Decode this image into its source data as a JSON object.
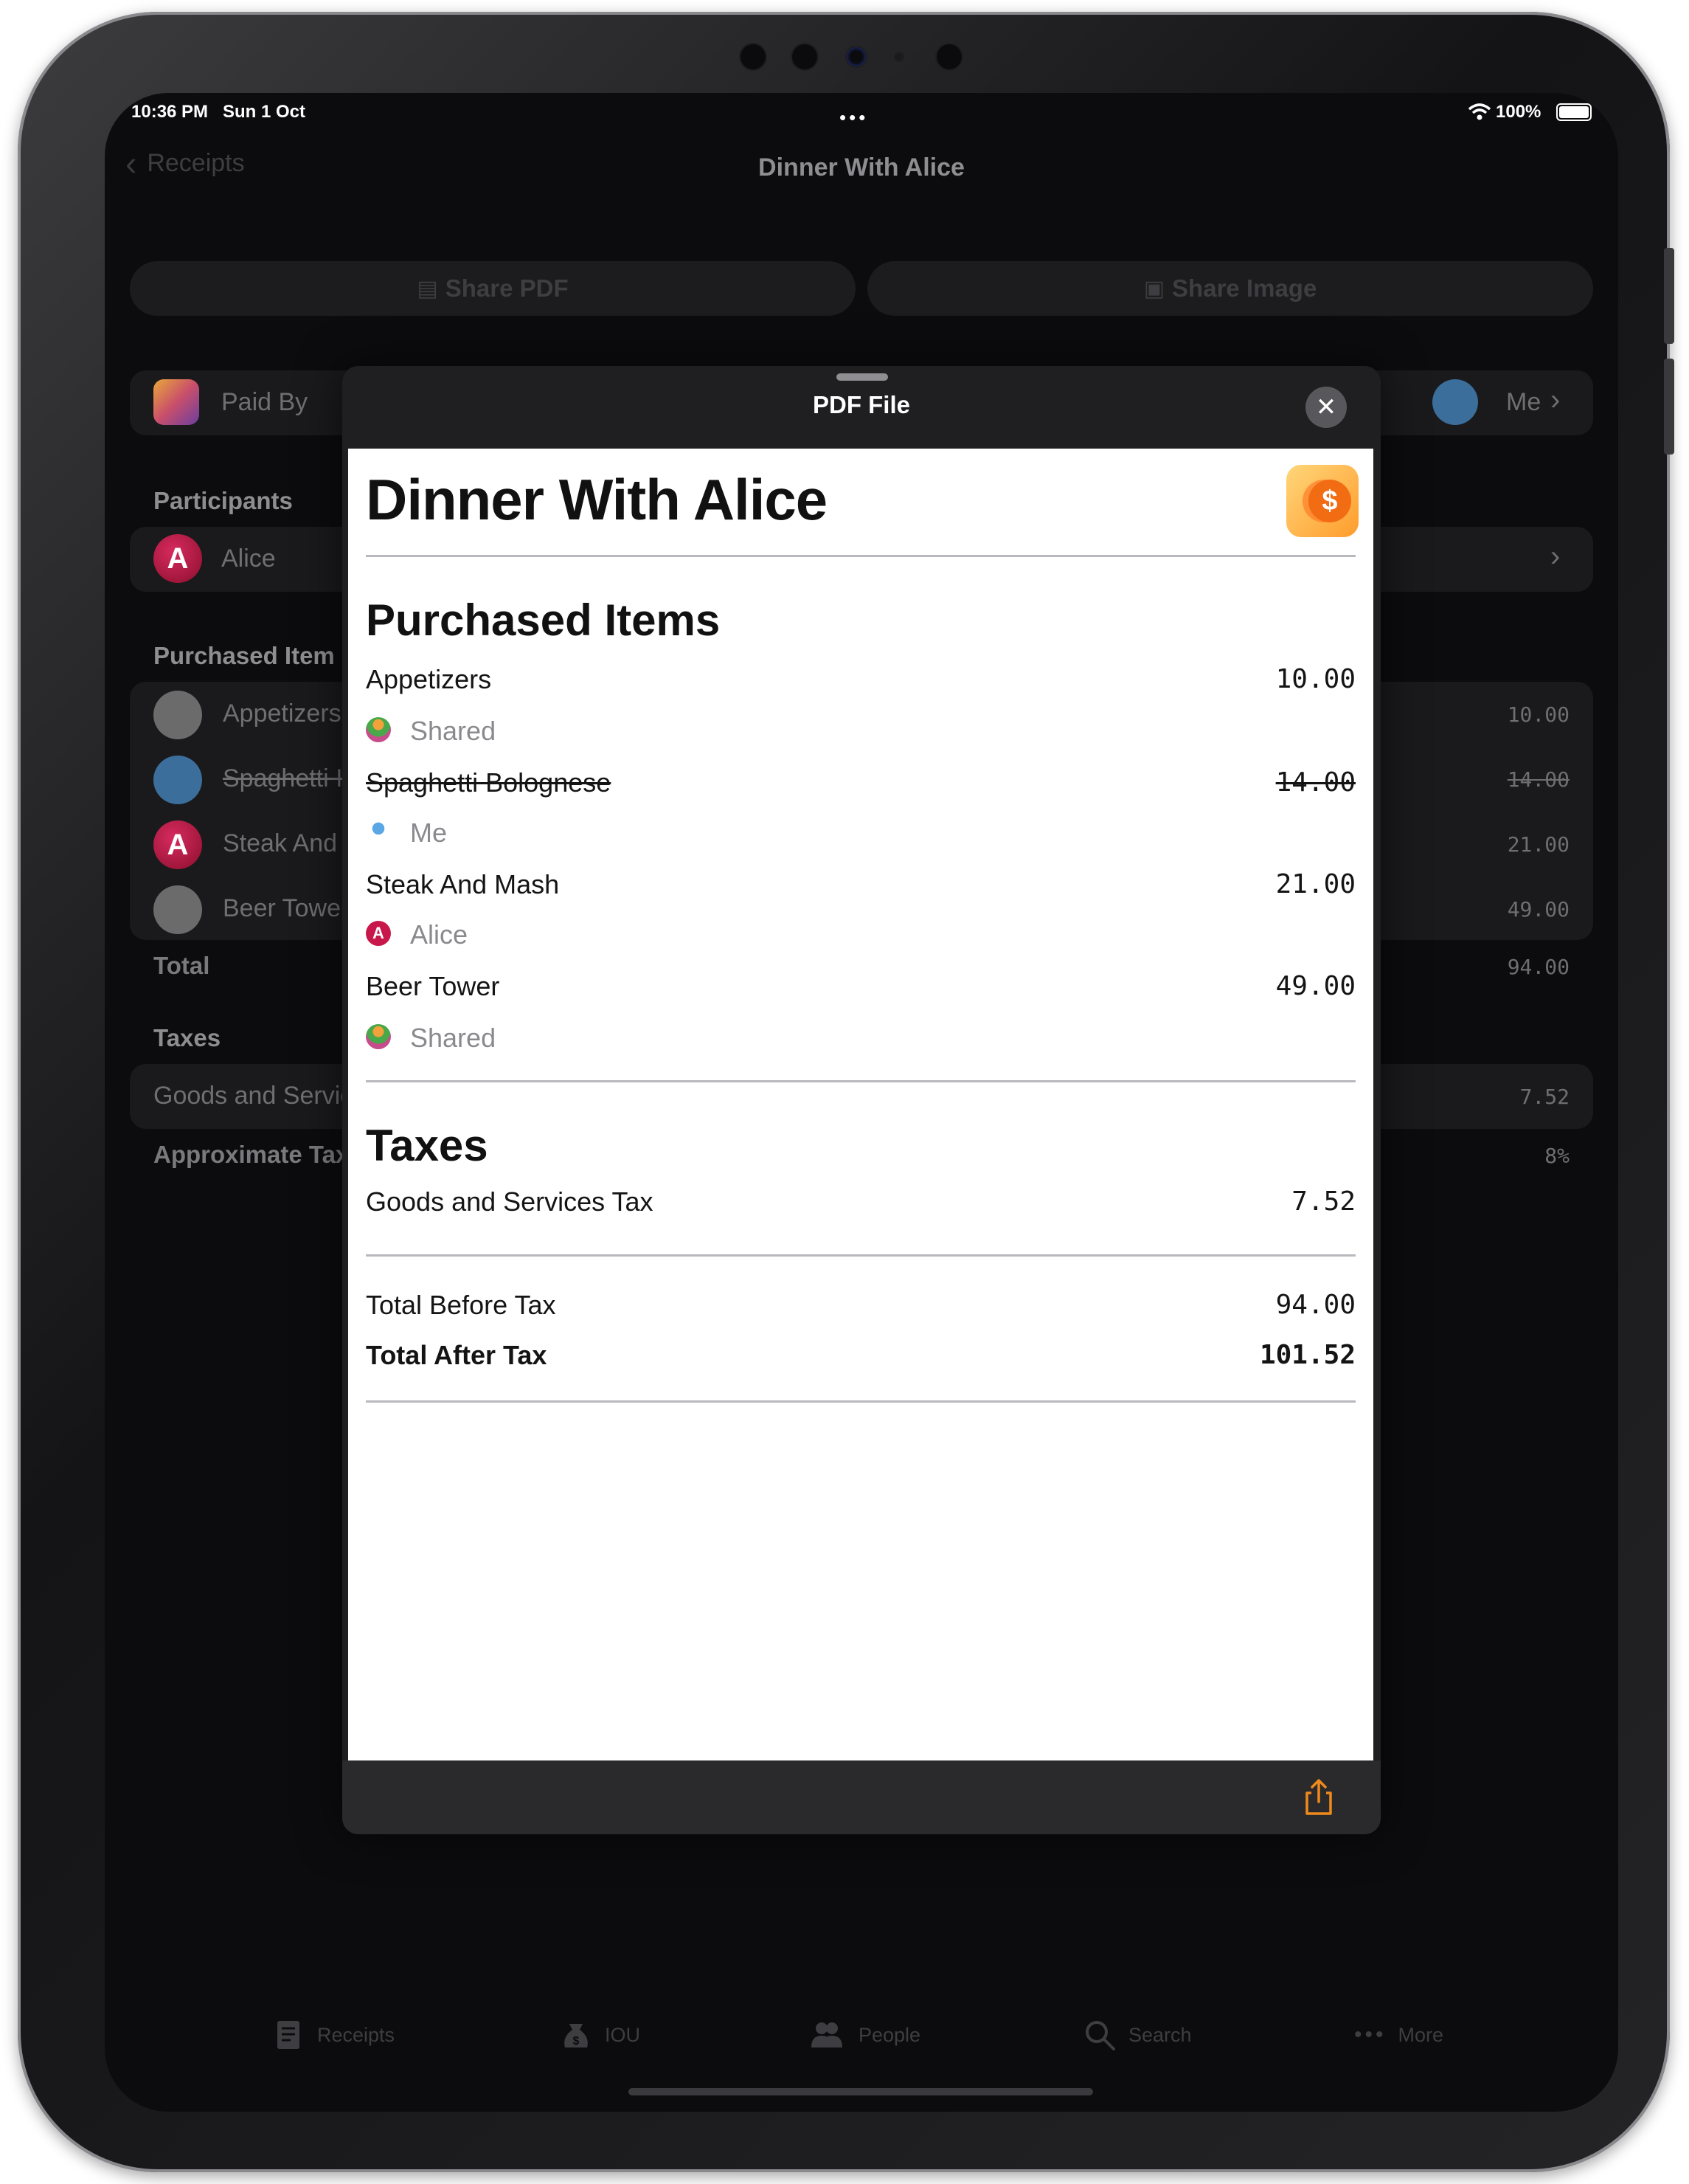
{
  "status_bar": {
    "time": "10:36 PM",
    "date": "Sun 1 Oct",
    "battery": "100%"
  },
  "nav": {
    "back_label": "Receipts",
    "title": "Dinner With Alice"
  },
  "actions": {
    "share_pdf": "Share PDF",
    "share_image": "Share Image"
  },
  "paid_by": {
    "label": "Paid By",
    "value": "Me"
  },
  "participants": {
    "header": "Participants",
    "items": [
      {
        "name": "Alice",
        "initial": "A"
      }
    ]
  },
  "purchased": {
    "header": "Purchased Item",
    "items": [
      {
        "label": "Appetizers",
        "value": "10.00"
      },
      {
        "label": "Spaghetti I",
        "value": "14.00"
      },
      {
        "label": "Steak And",
        "value": "21.00"
      },
      {
        "label": "Beer Towe",
        "value": "49.00"
      }
    ],
    "total_label": "Total",
    "total_value": "94.00"
  },
  "taxes": {
    "header": "Taxes",
    "items": [
      {
        "label": "Goods and Servic",
        "value": "7.52"
      }
    ],
    "approx_label": "Approximate Tax",
    "approx_value": "8%"
  },
  "sheet": {
    "title": "PDF File",
    "close_icon": "close-icon",
    "share_icon": "share-icon"
  },
  "pdf": {
    "title": "Dinner With Alice",
    "app_icon": "dollar-coin-icon",
    "items_header": "Purchased Items",
    "items": [
      {
        "name": "Appetizers",
        "price": "10.00",
        "owner": "Shared",
        "crossed": false
      },
      {
        "name": "Spaghetti Bolognese",
        "price": "14.00",
        "owner": "Me",
        "crossed": true
      },
      {
        "name": "Steak And Mash",
        "price": "21.00",
        "owner": "Alice",
        "crossed": false
      },
      {
        "name": "Beer Tower",
        "price": "49.00",
        "owner": "Shared",
        "crossed": false
      }
    ],
    "taxes_header": "Taxes",
    "taxes": [
      {
        "name": "Goods and Services Tax",
        "price": "7.52"
      }
    ],
    "total_before_label": "Total Before Tax",
    "total_before_value": "94.00",
    "total_after_label": "Total After Tax",
    "total_after_value": "101.52"
  },
  "tabbar": [
    {
      "label": "Receipts",
      "icon": "receipt-icon"
    },
    {
      "label": "IOU",
      "icon": "money-bag-icon"
    },
    {
      "label": "People",
      "icon": "people-icon"
    },
    {
      "label": "Search",
      "icon": "search-icon"
    },
    {
      "label": "More",
      "icon": "more-icon"
    }
  ],
  "colors": {
    "accent": "#ef8a1c",
    "alice": "#c8174a",
    "background": "#0c0c0e"
  }
}
